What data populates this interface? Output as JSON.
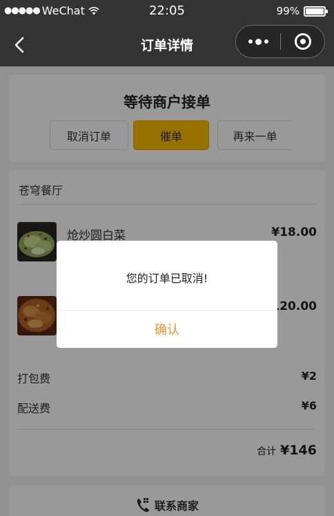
{
  "status_bar": {
    "signal": "●●●●●",
    "carrier": "WeChat",
    "time": "22:05",
    "battery": "99%",
    "battery_level": 0.99
  },
  "nav": {
    "title": "订单详情",
    "back_icon": "chevron-left-icon",
    "more_icon": "more-dots-icon",
    "close_icon": "target-circle-icon"
  },
  "order_status": {
    "title": "等待商户接单",
    "buttons": {
      "cancel": "取消订单",
      "urge": "催单",
      "reorder": "再来一单"
    },
    "accent_color": "#fcbe00"
  },
  "order": {
    "shop_name": "苍穹餐厅",
    "items": [
      {
        "name": "炝炒圆白菜",
        "price": "¥18.00",
        "image": "stir-fried-cabbage-photo"
      },
      {
        "name": "",
        "price": "120.00",
        "image": "meat-dish-photo"
      }
    ],
    "fees": {
      "packing_label": "打包费",
      "packing_value": "¥2",
      "delivery_label": "配送费",
      "delivery_value": "¥6"
    },
    "total_label": "合计",
    "total_value": "¥146"
  },
  "contact": {
    "label": "联系商家",
    "icon": "phone-icon"
  },
  "modal": {
    "message": "您的订单已取消!",
    "confirm": "确认",
    "confirm_color": "#f0942a"
  }
}
